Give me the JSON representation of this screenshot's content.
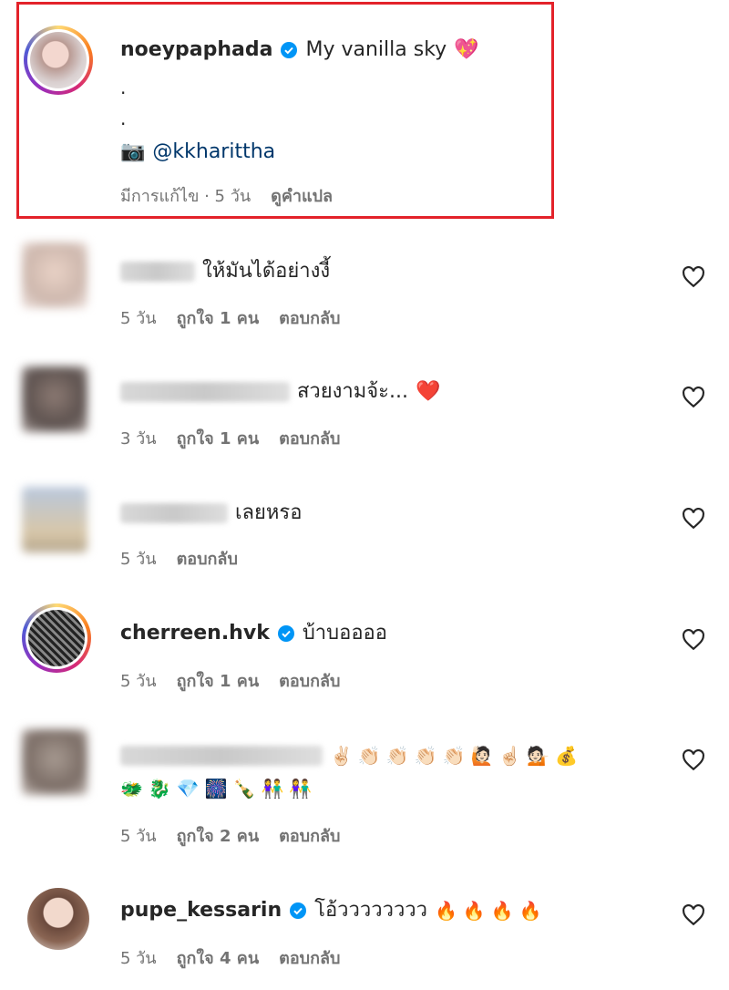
{
  "caption": {
    "username": "noeypaphada",
    "text": "My vanilla sky",
    "text_emoji": "💖",
    "line2": ".",
    "line3": ".",
    "credit_emoji": "📷",
    "mention": "@kkharittha",
    "edited": "มีการแก้ไข · 5 วัน",
    "translate": "ดูคำแปล",
    "highlight_color": "#e3222a"
  },
  "comments": [
    {
      "username": "",
      "text": "ให้มันได้อย่างงี้",
      "time": "5 วัน",
      "likes": "ถูกใจ 1 คน",
      "reply": "ตอบกลับ"
    },
    {
      "username": "",
      "text": "สวยงามจ้ะ...",
      "text_emoji": "❤️",
      "time": "3 วัน",
      "likes": "ถูกใจ 1 คน",
      "reply": "ตอบกลับ"
    },
    {
      "username": "",
      "text": "เลยหรอ",
      "time": "5 วัน",
      "reply": "ตอบกลับ"
    },
    {
      "username": "cherreen.hvk",
      "text": "บ้าบออออ",
      "time": "5 วัน",
      "likes": "ถูกใจ 1 คน",
      "reply": "ตอบกลับ"
    },
    {
      "username": "",
      "emoji_line1": "✌🏻👏🏻👏🏻👏🏻👏🏻🙋🏻☝🏻💁🏻💰",
      "emoji_line2": "🐲🐉💎🎆🍾👫👫",
      "time": "5 วัน",
      "likes": "ถูกใจ 2 คน",
      "reply": "ตอบกลับ"
    },
    {
      "username": "pupe_kessarin",
      "text": "โอ้วววววววว",
      "text_emoji": "🔥🔥🔥🔥",
      "time": "5 วัน",
      "likes": "ถูกใจ 4 คน",
      "reply": "ตอบกลับ"
    }
  ],
  "icons": {
    "verified": "verified-badge-icon",
    "like": "heart-outline-icon"
  },
  "colors": {
    "verified": "#0095f6",
    "meta": "#737373",
    "mention": "#00376b"
  }
}
